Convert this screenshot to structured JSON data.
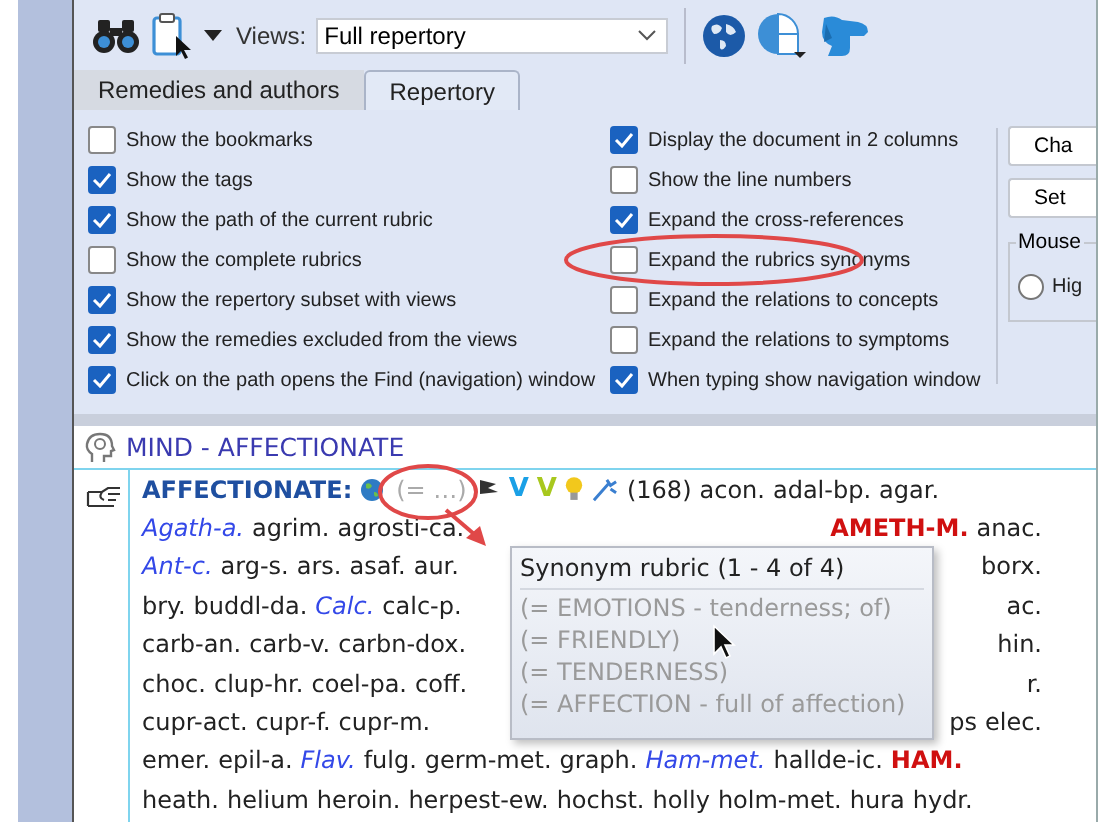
{
  "toolbar": {
    "views_label": "Views:",
    "views_value": "Full repertory"
  },
  "tabs": [
    {
      "label": "Remedies and authors",
      "selected": false
    },
    {
      "label": "Repertory",
      "selected": true
    }
  ],
  "options_left": [
    {
      "label": "Show the bookmarks",
      "checked": false
    },
    {
      "label": "Show the tags",
      "checked": true
    },
    {
      "label": "Show the path of the current rubric",
      "checked": true
    },
    {
      "label": "Show the complete rubrics",
      "checked": false
    },
    {
      "label": "Show the repertory subset with views",
      "checked": true
    },
    {
      "label": "Show the remedies excluded from the views",
      "checked": true
    },
    {
      "label": "Click on the path opens the Find (navigation) window",
      "checked": true
    }
  ],
  "options_right": [
    {
      "label": "Display the document in 2 columns",
      "checked": true,
      "highlighted": false
    },
    {
      "label": "Show the line numbers",
      "checked": false,
      "highlighted": false
    },
    {
      "label": "Expand the cross-references",
      "checked": true,
      "highlighted": false
    },
    {
      "label": "Expand the rubrics synonyms",
      "checked": false,
      "highlighted": true
    },
    {
      "label": "Expand the relations to concepts",
      "checked": false,
      "highlighted": false
    },
    {
      "label": "Expand the relations to symptoms",
      "checked": false,
      "highlighted": false
    },
    {
      "label": "When typing show navigation window",
      "checked": true,
      "highlighted": false
    }
  ],
  "side_buttons": [
    "Cha",
    "Set"
  ],
  "mouse_group": {
    "title": "Mouse",
    "radio": {
      "label": "Hig",
      "selected": false
    }
  },
  "rubric": {
    "path": "MIND - AFFECTIONATE",
    "title": "AFFECTIONATE:",
    "synonym_marker": "(= …)",
    "synonym_highlighted": true,
    "marks": [
      {
        "text": "V",
        "color": "#1aa0e6"
      },
      {
        "text": "V",
        "color": "#a8c81e"
      }
    ],
    "head": [
      "(168)",
      "acon.",
      "adal-bp.",
      "agar."
    ],
    "lines": [
      {
        "left": [
          {
            "text": "Agath-a.",
            "kind": "italic"
          },
          {
            "text": "agrim.",
            "kind": "plain"
          },
          {
            "text": "agrosti-ca.",
            "kind": "plain"
          }
        ],
        "right": [
          {
            "text": "AMETH-M.",
            "kind": "bold"
          },
          {
            "text": "anac.",
            "kind": "plain"
          }
        ]
      },
      {
        "left": [
          {
            "text": "Ant-c.",
            "kind": "italic"
          },
          {
            "text": "arg-s.",
            "kind": "plain"
          },
          {
            "text": "ars.",
            "kind": "plain"
          },
          {
            "text": "asaf.",
            "kind": "plain"
          },
          {
            "text": "aur.",
            "kind": "plain"
          }
        ],
        "right": [
          {
            "text": "borx.",
            "kind": "plain"
          }
        ]
      },
      {
        "left": [
          {
            "text": "bry.",
            "kind": "plain"
          },
          {
            "text": "buddl-da.",
            "kind": "plain"
          },
          {
            "text": "Calc.",
            "kind": "italic"
          },
          {
            "text": "calc-p.",
            "kind": "plain"
          }
        ],
        "right": [
          {
            "text": "ac.",
            "kind": "plain"
          }
        ]
      },
      {
        "left": [
          {
            "text": "carb-an.",
            "kind": "plain"
          },
          {
            "text": "carb-v.",
            "kind": "plain"
          },
          {
            "text": "carbn-dox.",
            "kind": "plain"
          }
        ],
        "right": [
          {
            "text": "hin.",
            "kind": "plain"
          }
        ]
      },
      {
        "left": [
          {
            "text": "choc.",
            "kind": "plain"
          },
          {
            "text": "clup-hr.",
            "kind": "plain"
          },
          {
            "text": "coel-pa.",
            "kind": "plain"
          },
          {
            "text": "coff.",
            "kind": "plain"
          }
        ],
        "right": [
          {
            "text": "r.",
            "kind": "plain"
          }
        ]
      },
      {
        "left": [
          {
            "text": "cupr-act.",
            "kind": "plain"
          },
          {
            "text": "cupr-f.",
            "kind": "plain"
          },
          {
            "text": "cupr-m.",
            "kind": "plain"
          }
        ],
        "right": [
          {
            "text": "ps",
            "kind": "plain"
          },
          {
            "text": "elec.",
            "kind": "plain"
          }
        ]
      },
      {
        "left": [
          {
            "text": "emer.",
            "kind": "plain"
          },
          {
            "text": "epil-a.",
            "kind": "plain"
          },
          {
            "text": "Flav.",
            "kind": "italic"
          },
          {
            "text": "fulg.",
            "kind": "plain"
          },
          {
            "text": "germ-met.",
            "kind": "plain"
          },
          {
            "text": "graph.",
            "kind": "plain"
          },
          {
            "text": "Ham-met.",
            "kind": "italic"
          },
          {
            "text": "hallde-ic.",
            "kind": "plain"
          },
          {
            "text": "HAM.",
            "kind": "bold"
          }
        ]
      },
      {
        "left": [
          {
            "text": "heath.",
            "kind": "plain"
          },
          {
            "text": "helium",
            "kind": "plain"
          },
          {
            "text": "heroin.",
            "kind": "plain"
          },
          {
            "text": "herpest-ew.",
            "kind": "plain"
          },
          {
            "text": "hochst.",
            "kind": "plain"
          },
          {
            "text": "holly",
            "kind": "plain"
          },
          {
            "text": "holm-met.",
            "kind": "plain"
          },
          {
            "text": "hura",
            "kind": "plain"
          },
          {
            "text": "hydr.",
            "kind": "plain"
          }
        ]
      }
    ]
  },
  "popup": {
    "title": "Synonym rubric (1 - 4 of 4)",
    "items": [
      "(= EMOTIONS - tenderness; of)",
      "(= FRIENDLY)",
      "(= TENDERNESS)",
      "(= AFFECTION - full of affection)"
    ]
  }
}
